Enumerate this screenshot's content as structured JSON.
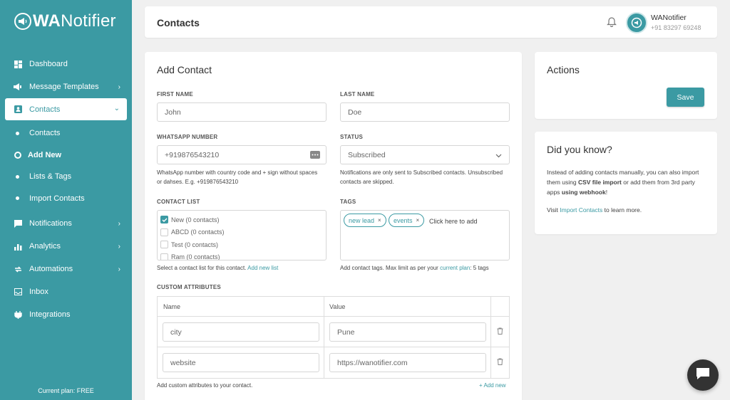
{
  "brand": {
    "logo_bold": "WA",
    "logo_rest": "Notifier"
  },
  "sidebar": {
    "items": [
      {
        "label": "Dashboard"
      },
      {
        "label": "Message Templates"
      },
      {
        "label": "Contacts"
      },
      {
        "label": "Notifications"
      },
      {
        "label": "Analytics"
      },
      {
        "label": "Automations"
      },
      {
        "label": "Inbox"
      },
      {
        "label": "Integrations"
      }
    ],
    "contacts_sub": [
      {
        "label": "Contacts"
      },
      {
        "label": "Add New"
      },
      {
        "label": "Lists & Tags"
      },
      {
        "label": "Import Contacts"
      }
    ],
    "plan": "Current plan: FREE"
  },
  "header": {
    "title": "Contacts",
    "user_name": "WANotifier",
    "user_phone": "+91 83297 69248"
  },
  "form": {
    "title": "Add Contact",
    "first_name": {
      "label": "FIRST NAME",
      "value": "John"
    },
    "last_name": {
      "label": "LAST NAME",
      "value": "Doe"
    },
    "whatsapp": {
      "label": "WHATSAPP NUMBER",
      "value": "+919876543210",
      "help": "WhatsApp number with country code and + sign without spaces or dahses. E.g. +919876543210"
    },
    "status": {
      "label": "STATUS",
      "value": "Subscribed",
      "help": "Notifications are only sent to Subscribed contacts. Unsubscribed contacts are skipped."
    },
    "contact_list": {
      "label": "CONTACT LIST",
      "items": [
        {
          "label": "New (0 contacts)",
          "checked": true
        },
        {
          "label": "ABCD (0 contacts)",
          "checked": false
        },
        {
          "label": "Test (0 contacts)",
          "checked": false
        },
        {
          "label": "Ram (0 contacts)",
          "checked": false
        }
      ],
      "help": "Select a contact list for this contact.",
      "help_link": "Add new list"
    },
    "tags": {
      "label": "TAGS",
      "items": [
        "new lead",
        "events"
      ],
      "placeholder": "Click here to add",
      "help_prefix": "Add contact tags. Max limit as per your",
      "help_link": "current plan",
      "help_suffix": ": 5 tags"
    },
    "custom_attributes": {
      "label": "CUSTOM ATTRIBUTES",
      "col_name": "Name",
      "col_value": "Value",
      "rows": [
        {
          "name": "city",
          "value": "Pune"
        },
        {
          "name": "website",
          "value": "https://wanotifier.com"
        }
      ],
      "help": "Add custom attributes to your contact.",
      "add_new": "Add new"
    }
  },
  "actions": {
    "title": "Actions",
    "save_label": "Save"
  },
  "tips": {
    "title": "Did you know?",
    "p1_a": "Instead of adding contacts manually, you can also import them using",
    "p1_b": "CSV file import",
    "p1_c": "or add them from 3rd party apps",
    "p1_d": "using webhook",
    "p1_e": "!",
    "p2_a": "Visit",
    "p2_link": "Import Contacts",
    "p2_b": "to learn more."
  },
  "colors": {
    "accent": "#3b9aa3",
    "background": "#f0f0f0"
  }
}
